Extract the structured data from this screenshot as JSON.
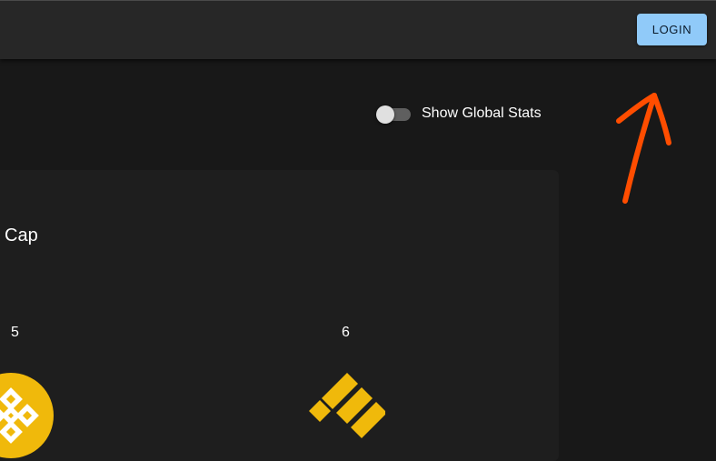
{
  "header": {
    "login_label": "LOGIN"
  },
  "controls": {
    "global_stats_label": "Show Global Stats",
    "global_stats_enabled": false
  },
  "card": {
    "title_fragment": "Cap",
    "items": [
      {
        "rank": "5",
        "logo_icon": "bnb-logo-icon"
      },
      {
        "rank": "6",
        "logo_icon": "busd-logo-icon"
      }
    ]
  },
  "colors": {
    "appbar": "#272727",
    "background": "#181818",
    "card": "#1e1e1e",
    "login_button": "#90caf9",
    "coin_yellow": "#f0b90b",
    "annotation_arrow": "#ff4d00"
  },
  "annotation": {
    "icon": "arrow-up-icon"
  }
}
